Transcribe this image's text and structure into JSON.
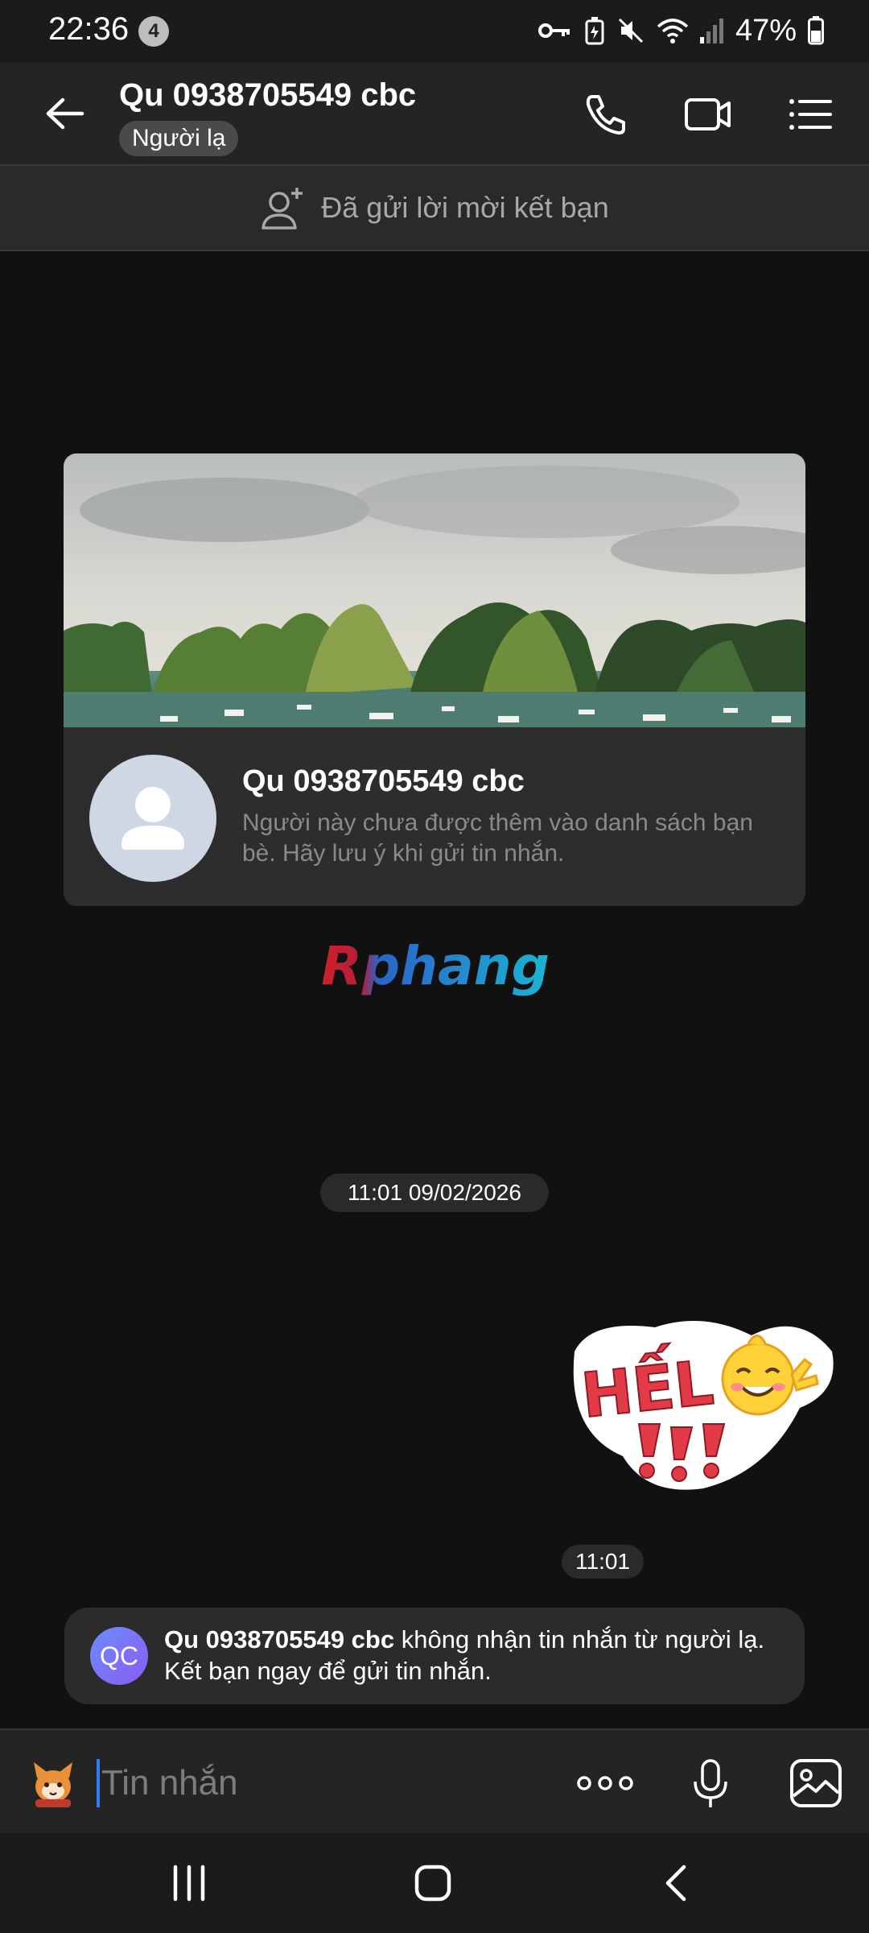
{
  "status_bar": {
    "time": "22:36",
    "notification_count": "4",
    "battery": "47%",
    "icons": [
      "key-icon",
      "battery-saver-icon",
      "mute-icon",
      "wifi-icon",
      "signal-icon",
      "battery-icon"
    ]
  },
  "header": {
    "title": "Qu 0938705549 cbc",
    "tag": "Người lạ",
    "icons": [
      "back-arrow-icon",
      "phone-icon",
      "video-call-icon",
      "menu-list-icon"
    ]
  },
  "banner": {
    "text": "Đã gửi lời mời kết bạn",
    "icon": "add-friend-icon"
  },
  "profile_card": {
    "name": "Qu 0938705549 cbc",
    "description": "Người này chưa được thêm vào danh sách bạn bè. Hãy lưu ý khi gửi tin nhắn."
  },
  "watermark": "Rphang",
  "chat": {
    "date_separator": "11:01 09/02/2026",
    "sticker_text": "HẾL",
    "sticker_time": "11:01"
  },
  "notice": {
    "avatar_initials": "QC",
    "name": "Qu 0938705549 cbc",
    "text": " không nhận tin nhắn từ người lạ. Kết bạn ngay để gửi tin nhắn."
  },
  "input_bar": {
    "placeholder": "Tin nhắn",
    "icons": [
      "sticker-emoji-icon",
      "more-options-icon",
      "microphone-icon",
      "image-gallery-icon"
    ]
  },
  "nav_bar": {
    "icons": [
      "recent-apps-icon",
      "home-icon",
      "back-nav-icon"
    ]
  },
  "colors": {
    "background": "#111111",
    "header": "#242424",
    "accent_caret": "#2f7cf6",
    "muted_text": "#8a8a8a"
  }
}
